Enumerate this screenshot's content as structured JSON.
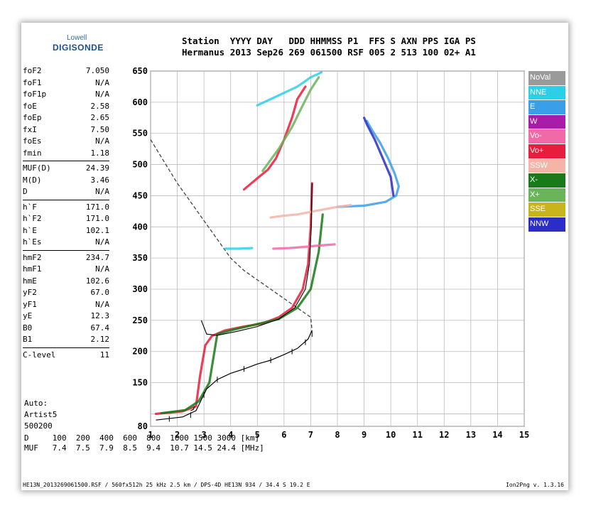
{
  "logo": {
    "line1": "Lowell",
    "line2": "DIGISONDE"
  },
  "header": {
    "line1": "Station  YYYY DAY   DDD HHMMSS P1  FFS S AXN PPS IGA PS",
    "line2": "Hermanus 2013 Sep26 269 061500 RSF 005 2 513 100 02+ A1"
  },
  "params": [
    {
      "group": [
        {
          "name": "foF2",
          "value": "7.050"
        },
        {
          "name": "foF1",
          "value": "N/A"
        },
        {
          "name": "foF1p",
          "value": "N/A"
        },
        {
          "name": "foE",
          "value": "2.58"
        },
        {
          "name": "foEp",
          "value": "2.65"
        },
        {
          "name": "fxI",
          "value": "7.50"
        },
        {
          "name": "foEs",
          "value": "N/A"
        },
        {
          "name": "fmin",
          "value": "1.18"
        }
      ]
    },
    {
      "group": [
        {
          "name": "MUF(D)",
          "value": "24.39"
        },
        {
          "name": "M(D)",
          "value": "3.46"
        },
        {
          "name": "D",
          "value": "N/A"
        }
      ]
    },
    {
      "group": [
        {
          "name": "h`F",
          "value": "171.0"
        },
        {
          "name": "h`F2",
          "value": "171.0"
        },
        {
          "name": "h`E",
          "value": "102.1"
        },
        {
          "name": "h`Es",
          "value": "N/A"
        }
      ]
    },
    {
      "group": [
        {
          "name": "hmF2",
          "value": "234.7"
        },
        {
          "name": "hmF1",
          "value": "N/A"
        },
        {
          "name": "hmE",
          "value": "102.6"
        },
        {
          "name": "yF2",
          "value": "67.0"
        },
        {
          "name": "yF1",
          "value": "N/A"
        },
        {
          "name": "yE",
          "value": "12.3"
        },
        {
          "name": "B0",
          "value": "67.4"
        },
        {
          "name": "B1",
          "value": "2.12"
        }
      ]
    },
    {
      "group": [
        {
          "name": "C-level",
          "value": "11"
        }
      ]
    }
  ],
  "auto": {
    "line1": "Auto:",
    "line2": "Artist5",
    "line3": "500200"
  },
  "muf_table": {
    "line1": "D     100  200  400  600  800  1000 1500 3000 [km]",
    "line2": "MUF   7.4  7.5  7.9  8.5  9.4  10.7 14.5 24.4 [MHz]"
  },
  "footer": {
    "left": "HE13N_2013269061500.RSF / 560fx512h 25 kHz 2.5 km / DPS-4D HE13N 934 / 34.4 S 19.2 E",
    "right": "Ion2Png v. 1.3.16"
  },
  "legend": [
    {
      "label": "NoVal",
      "color": "#9a9a9a"
    },
    {
      "label": "NNE",
      "color": "#2ccfe8"
    },
    {
      "label": "E",
      "color": "#3a9ee8"
    },
    {
      "label": "W",
      "color": "#a81ca8"
    },
    {
      "label": "Vo-",
      "color": "#f06aa8"
    },
    {
      "label": "Vo+",
      "color": "#e81c3c"
    },
    {
      "label": "SSW",
      "color": "#f4b4a8"
    },
    {
      "label": "X-",
      "color": "#187a18"
    },
    {
      "label": "X+",
      "color": "#6ab45a"
    },
    {
      "label": "SSE",
      "color": "#c8b41c"
    },
    {
      "label": "NNW",
      "color": "#2c2cc8"
    }
  ],
  "chart_data": {
    "type": "scatter",
    "xlim": [
      1,
      15
    ],
    "ylim": [
      80,
      650
    ],
    "x_ticks": [
      1,
      2,
      3,
      4,
      5,
      6,
      7,
      8,
      9,
      10,
      11,
      12,
      13,
      14,
      15
    ],
    "y_ticks": [
      80,
      100,
      150,
      200,
      250,
      300,
      350,
      400,
      450,
      500,
      550,
      600,
      650
    ],
    "y_tick_labels": [
      {
        "value": 80,
        "label": "80"
      },
      {
        "value": 150,
        "label": "150"
      },
      {
        "value": 200,
        "label": "200"
      },
      {
        "value": 250,
        "label": "250"
      },
      {
        "value": 300,
        "label": "300"
      },
      {
        "value": 350,
        "label": "350"
      },
      {
        "value": 400,
        "label": "400"
      },
      {
        "value": 450,
        "label": "450"
      },
      {
        "value": 500,
        "label": "500"
      },
      {
        "value": 550,
        "label": "550"
      },
      {
        "value": 600,
        "label": "600"
      },
      {
        "value": 650,
        "label": "650"
      }
    ],
    "grid": true,
    "traces": [
      {
        "name": "Vo+",
        "color": "#e81c3c",
        "points": [
          [
            1.2,
            100
          ],
          [
            2.2,
            104
          ],
          [
            2.7,
            112
          ],
          [
            2.85,
            160
          ],
          [
            3.05,
            210
          ],
          [
            3.3,
            225
          ],
          [
            3.8,
            234
          ],
          [
            4.5,
            240
          ],
          [
            5.2,
            245
          ],
          [
            5.8,
            255
          ],
          [
            6.3,
            270
          ],
          [
            6.7,
            300
          ],
          [
            6.9,
            340
          ],
          [
            7.0,
            400
          ],
          [
            7.05,
            470
          ]
        ]
      },
      {
        "name": "X-",
        "color": "#187a18",
        "points": [
          [
            1.4,
            101
          ],
          [
            2.3,
            106
          ],
          [
            2.8,
            120
          ],
          [
            3.2,
            150
          ],
          [
            3.5,
            228
          ],
          [
            4.2,
            236
          ],
          [
            5.0,
            244
          ],
          [
            5.8,
            252
          ],
          [
            6.5,
            270
          ],
          [
            7.0,
            300
          ],
          [
            7.3,
            360
          ],
          [
            7.45,
            420
          ]
        ]
      },
      {
        "name": "Vo+ 2F",
        "color": "#e81c3c",
        "points": [
          [
            4.5,
            460
          ],
          [
            5.0,
            478
          ],
          [
            5.4,
            492
          ],
          [
            5.7,
            510
          ],
          [
            6.0,
            540
          ],
          [
            6.3,
            575
          ],
          [
            6.5,
            605
          ],
          [
            6.8,
            625
          ]
        ]
      },
      {
        "name": "X+ 2F",
        "color": "#6ab45a",
        "points": [
          [
            5.2,
            490
          ],
          [
            5.8,
            525
          ],
          [
            6.3,
            560
          ],
          [
            6.7,
            595
          ],
          [
            7.0,
            620
          ],
          [
            7.3,
            640
          ]
        ]
      },
      {
        "name": "E oblique",
        "color": "#3a9ee8",
        "points": [
          [
            8.0,
            432
          ],
          [
            9.0,
            434
          ],
          [
            9.8,
            440
          ],
          [
            10.2,
            450
          ],
          [
            10.3,
            465
          ],
          [
            10.15,
            485
          ],
          [
            9.9,
            510
          ],
          [
            9.6,
            535
          ],
          [
            9.3,
            555
          ],
          [
            9.1,
            570
          ]
        ]
      },
      {
        "name": "NNW oblique",
        "color": "#2c2cc8",
        "points": [
          [
            10.1,
            450
          ],
          [
            10.0,
            480
          ],
          [
            9.7,
            510
          ],
          [
            9.4,
            540
          ],
          [
            9.1,
            565
          ],
          [
            9.0,
            575
          ]
        ]
      },
      {
        "name": "SSW",
        "color": "#f4b4a8",
        "points": [
          [
            5.5,
            415
          ],
          [
            6.0,
            418
          ],
          [
            6.5,
            420
          ],
          [
            7.0,
            424
          ],
          [
            7.5,
            428
          ],
          [
            8.0,
            432
          ],
          [
            8.5,
            435
          ]
        ]
      },
      {
        "name": "Vo- spread",
        "color": "#f06aa8",
        "points": [
          [
            5.6,
            365
          ],
          [
            6.2,
            366
          ],
          [
            6.8,
            368
          ],
          [
            7.3,
            370
          ],
          [
            7.9,
            372
          ]
        ]
      },
      {
        "name": "NNE",
        "color": "#2ccfe8",
        "points": [
          [
            3.8,
            365
          ],
          [
            4.3,
            365
          ],
          [
            4.8,
            366
          ]
        ]
      },
      {
        "name": "NNE top",
        "color": "#2ccfe8",
        "points": [
          [
            5.0,
            595
          ],
          [
            5.5,
            605
          ],
          [
            6.0,
            615
          ],
          [
            6.5,
            625
          ],
          [
            7.0,
            640
          ],
          [
            7.4,
            648
          ]
        ]
      }
    ],
    "profile": [
      [
        1.2,
        90
      ],
      [
        2.2,
        95
      ],
      [
        2.7,
        105
      ],
      [
        3.1,
        140
      ],
      [
        3.5,
        155
      ],
      [
        4.0,
        165
      ],
      [
        4.5,
        172
      ],
      [
        5.0,
        180
      ],
      [
        5.5,
        186
      ],
      [
        6.0,
        195
      ],
      [
        6.5,
        205
      ],
      [
        6.9,
        220
      ],
      [
        7.05,
        234
      ]
    ],
    "profile_ticks": [
      [
        1.7,
        92
      ],
      [
        2.5,
        98
      ],
      [
        3.0,
        130
      ],
      [
        3.5,
        155
      ],
      [
        4.5,
        172
      ],
      [
        5.5,
        186
      ],
      [
        6.3,
        200
      ],
      [
        6.8,
        215
      ],
      [
        7.05,
        228
      ]
    ],
    "model_dashed": [
      [
        1.0,
        540
      ],
      [
        1.5,
        505
      ],
      [
        2.0,
        470
      ],
      [
        2.5,
        440
      ],
      [
        3.0,
        410
      ],
      [
        3.5,
        380
      ],
      [
        4.0,
        350
      ],
      [
        4.5,
        330
      ],
      [
        5.0,
        315
      ],
      [
        5.5,
        300
      ],
      [
        6.0,
        285
      ],
      [
        6.5,
        270
      ],
      [
        7.0,
        255
      ],
      [
        7.05,
        234
      ]
    ],
    "e_trace": [
      [
        2.5,
        105
      ],
      [
        2.6,
        107
      ],
      [
        2.65,
        112
      ]
    ],
    "f_trace_black": [
      [
        2.9,
        250
      ],
      [
        3.1,
        228
      ],
      [
        3.5,
        226
      ],
      [
        4.2,
        232
      ],
      [
        5.0,
        240
      ],
      [
        5.8,
        252
      ],
      [
        6.4,
        270
      ],
      [
        6.8,
        300
      ],
      [
        6.95,
        340
      ],
      [
        7.02,
        400
      ],
      [
        7.05,
        470
      ]
    ]
  }
}
